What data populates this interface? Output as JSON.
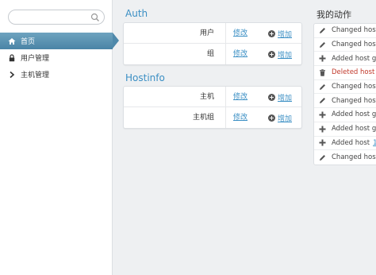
{
  "search": {
    "placeholder": "",
    "value": ""
  },
  "sidebar": {
    "items": [
      {
        "label": "首页",
        "icon": "home-icon",
        "active": true
      },
      {
        "label": "用户管理",
        "icon": "lock-icon",
        "active": false
      },
      {
        "label": "主机管理",
        "icon": "chevron-right-icon",
        "active": false
      }
    ]
  },
  "auth": {
    "title": "Auth",
    "rows": [
      {
        "name": "用户",
        "change": "修改",
        "add": "增加"
      },
      {
        "name": "组",
        "change": "修改",
        "add": "增加"
      }
    ]
  },
  "hostinfo": {
    "title": "Hostinfo",
    "rows": [
      {
        "name": "主机",
        "change": "修改",
        "add": "增加"
      },
      {
        "name": "主机组",
        "change": "修改",
        "add": "增加"
      }
    ]
  },
  "recent": {
    "title": "我的动作",
    "items": [
      {
        "icon": "pencil-icon",
        "text": "Changed host",
        "type": "changed"
      },
      {
        "icon": "pencil-icon",
        "text": "Changed host",
        "type": "changed"
      },
      {
        "icon": "plus-icon",
        "text": "Added host gr",
        "type": "added"
      },
      {
        "icon": "trash-icon",
        "text": "Deleted host",
        "type": "deleted"
      },
      {
        "icon": "pencil-icon",
        "text": "Changed host",
        "type": "changed"
      },
      {
        "icon": "pencil-icon",
        "text": "Changed host",
        "type": "changed"
      },
      {
        "icon": "plus-icon",
        "text": "Added host gr",
        "type": "added"
      },
      {
        "icon": "plus-icon",
        "text": "Added host gr",
        "type": "added"
      },
      {
        "icon": "plus-icon",
        "text": "Added host",
        "type": "added",
        "link": "1"
      },
      {
        "icon": "pencil-icon",
        "text": "Changed host",
        "type": "changed"
      }
    ]
  },
  "colors": {
    "accent": "#3b8fc4",
    "active_nav": "#4a84a6",
    "deleted": "#c0392b"
  }
}
